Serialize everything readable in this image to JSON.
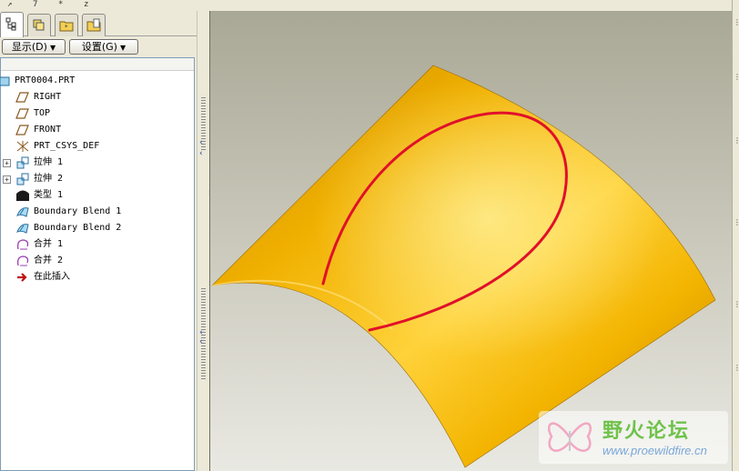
{
  "top_strip": {
    "items": [
      "↗",
      "7",
      "*",
      "z"
    ]
  },
  "tabs": [
    {
      "name": "model-tree",
      "icon": "model-tree-icon"
    },
    {
      "name": "layers",
      "icon": "layers-icon"
    },
    {
      "name": "folder-browser",
      "icon": "folder-icon"
    },
    {
      "name": "favorites",
      "icon": "favorites-icon"
    }
  ],
  "menus": {
    "display_label": "显示(D)",
    "settings_label": "设置(G)"
  },
  "tree": {
    "items": [
      {
        "label": "PRT0004.PRT",
        "icon": "part-icon",
        "expandable": false
      },
      {
        "label": "RIGHT",
        "icon": "datum-plane-icon",
        "expandable": false
      },
      {
        "label": "TOP",
        "icon": "datum-plane-icon",
        "expandable": false
      },
      {
        "label": "FRONT",
        "icon": "datum-plane-icon",
        "expandable": false
      },
      {
        "label": "PRT_CSYS_DEF",
        "icon": "csys-icon",
        "expandable": false
      },
      {
        "label": "拉伸 1",
        "icon": "extrude-icon",
        "expandable": true
      },
      {
        "label": "拉伸 2",
        "icon": "extrude-icon",
        "expandable": true
      },
      {
        "label": "类型 1",
        "icon": "style-icon",
        "expandable": false
      },
      {
        "label": "Boundary Blend 1",
        "icon": "boundary-blend-icon",
        "expandable": false
      },
      {
        "label": "Boundary Blend 2",
        "icon": "boundary-blend-icon",
        "expandable": false
      },
      {
        "label": "合并 1",
        "icon": "merge-icon",
        "expandable": false
      },
      {
        "label": "合并 2",
        "icon": "merge-icon",
        "expandable": false
      },
      {
        "label": "在此插入",
        "icon": "insert-here-icon",
        "expandable": false
      }
    ]
  },
  "watermark": {
    "title": "野火论坛",
    "url": "www.proewildfire.cn"
  },
  "colors": {
    "surface": "#e6a000",
    "curve": "#e0102a",
    "background_top": "#a9a795",
    "background_bottom": "#e9e9e3"
  }
}
